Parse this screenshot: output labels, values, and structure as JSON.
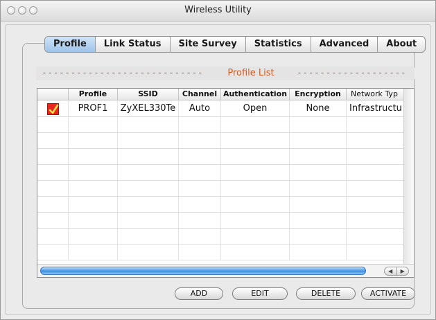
{
  "window": {
    "title": "Wireless Utility"
  },
  "tabs": [
    {
      "label": "Profile",
      "active": true
    },
    {
      "label": "Link Status",
      "active": false
    },
    {
      "label": "Site Survey",
      "active": false
    },
    {
      "label": "Statistics",
      "active": false
    },
    {
      "label": "Advanced",
      "active": false
    },
    {
      "label": "About",
      "active": false
    }
  ],
  "section": {
    "title": "Profile List",
    "dashes_left": "----------------------------",
    "dashes_right": "----------------------------"
  },
  "table": {
    "columns": [
      "",
      "Profile",
      "SSID",
      "Channel",
      "Authentication",
      "Encryption",
      "Network Typ"
    ],
    "rows": [
      {
        "active": true,
        "profile": "PROF1",
        "ssid": "ZyXEL330Te",
        "channel": "Auto",
        "authentication": "Open",
        "encryption": "None",
        "network_type": "Infrastructu"
      }
    ],
    "empty_row_count": 9
  },
  "buttons": {
    "add": "ADD",
    "edit": "EDIT",
    "delete": "DELETE",
    "activate": "ACTIVATE"
  },
  "colors": {
    "accent_orange": "#d25a1e",
    "active_tab": "#9ec3ea",
    "active_check": "#e8261e",
    "scroll_thumb": "#3c8fe0"
  },
  "icons": {
    "active_row": "checkmark-icon",
    "scroll_left": "◀",
    "scroll_right": "▶"
  }
}
